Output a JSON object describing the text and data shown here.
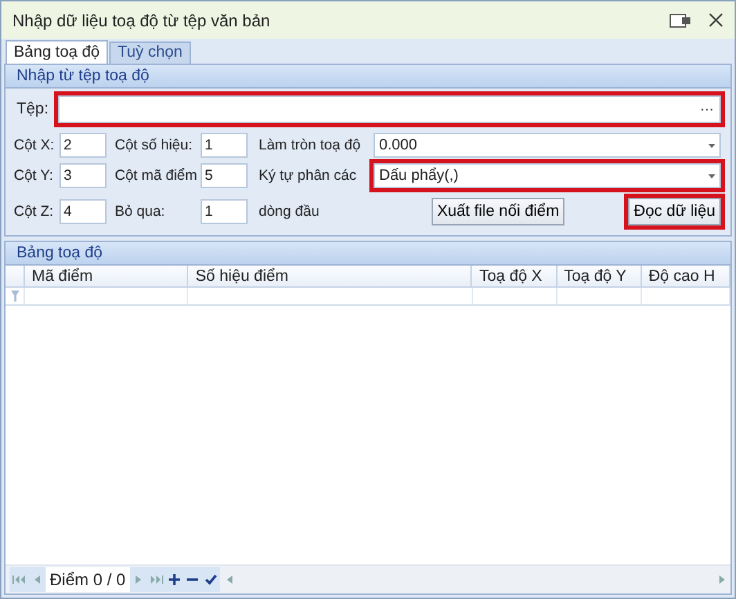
{
  "window": {
    "title": "Nhập dữ liệu toạ độ từ tệp văn bản"
  },
  "tabs": [
    {
      "label": "Bảng toạ độ",
      "selected": true
    },
    {
      "label": "Tuỳ chọn",
      "selected": false
    }
  ],
  "import_group": {
    "title": "Nhập từ tệp toạ độ",
    "file": {
      "label": "Tệp:",
      "browse": "···",
      "highlighted": true
    },
    "rows": [
      {
        "fields": [
          {
            "kind": "number",
            "label": "Cột X:",
            "value": "2"
          },
          {
            "kind": "number",
            "label": "Cột số hiệu:",
            "value": "1"
          },
          {
            "kind": "dropdown",
            "label": "Làm tròn toạ độ",
            "value": "0.000",
            "highlighted": false
          }
        ]
      },
      {
        "fields": [
          {
            "kind": "number",
            "label": "Cột Y:",
            "value": "3"
          },
          {
            "kind": "number",
            "label": "Cột mã điểm",
            "value": "5"
          },
          {
            "kind": "dropdown",
            "label": "Ký tự phân các",
            "value": "Dấu phẩy(,)",
            "highlighted": true
          }
        ]
      },
      {
        "fields": [
          {
            "kind": "number",
            "label": "Cột Z:",
            "value": "4"
          },
          {
            "kind": "number",
            "label": "Bỏ qua:",
            "value": "1",
            "suffix": "dòng đầu"
          }
        ]
      }
    ],
    "buttons": [
      {
        "label": "Xuất file nối điểm",
        "highlighted": false
      },
      {
        "label": "Đọc dữ liệu",
        "highlighted": true
      }
    ]
  },
  "grid": {
    "title": "Bảng toạ độ",
    "columns": [
      "Mã điểm",
      "Số hiệu điểm",
      "Toạ độ X",
      "Toạ độ Y",
      "Độ cao H"
    ],
    "navigator": {
      "record_text": "Điểm 0 / 0"
    }
  }
}
